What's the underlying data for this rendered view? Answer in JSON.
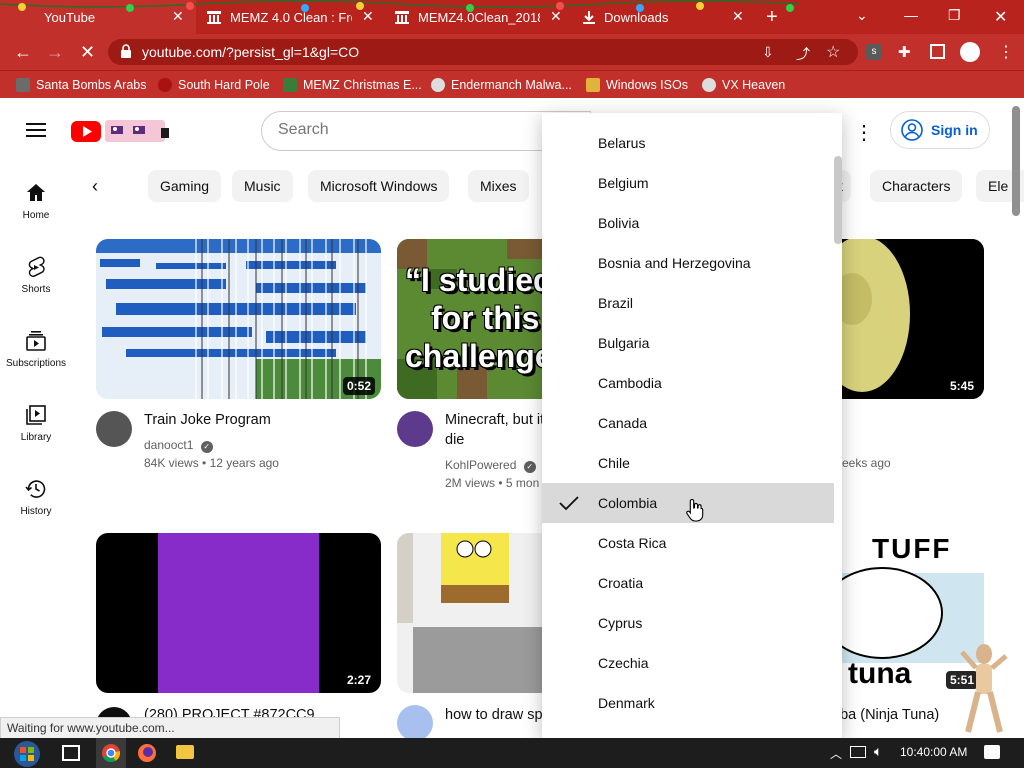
{
  "browser": {
    "tabs": [
      {
        "title": "YouTube",
        "active": true
      },
      {
        "title": "MEMZ 4.0 Clean : Free"
      },
      {
        "title": "MEMZ4.0Clean_20181"
      },
      {
        "title": "Downloads"
      }
    ],
    "url": "youtube.com/?persist_gl=1&gl=CO",
    "bookmarks": [
      "Santa Bombs Arabs",
      "South Hard Pole",
      "MEMZ Christmas E...",
      "Endermanch Malwa...",
      "Windows ISOs",
      "VX Heaven"
    ],
    "status_text": "Waiting for www.youtube.com..."
  },
  "youtube": {
    "search_placeholder": "Search",
    "signin_label": "Sign in",
    "side_nav": [
      {
        "label": "Home",
        "icon": "home-icon"
      },
      {
        "label": "Shorts",
        "icon": "shorts-icon"
      },
      {
        "label": "Subscriptions",
        "icon": "subscriptions-icon"
      },
      {
        "label": "Library",
        "icon": "library-icon"
      },
      {
        "label": "History",
        "icon": "history-icon"
      }
    ],
    "chips": [
      "Gaming",
      "Music",
      "Microsoft Windows",
      "Mixes",
      "k",
      "Characters",
      "Ele"
    ],
    "videos": [
      {
        "title": "Train Joke Program",
        "channel": "danooct1",
        "views": "84K views",
        "age": "12 years ago",
        "duration": "0:52"
      },
      {
        "title": "Minecraft, but it",
        "title2": "die",
        "channel": "KohlPowered",
        "views": "2M views",
        "age": "5 mon",
        "duration": ""
      },
      {
        "title": "",
        "channel": "",
        "views": "",
        "age": "eeks ago",
        "duration": "5:45"
      },
      {
        "title": "(280) PROJECT #872CC9",
        "channel": "",
        "views": "",
        "age": "",
        "duration": "2:27"
      },
      {
        "title": "how to draw spo",
        "channel": "",
        "views": "",
        "age": "",
        "duration": ""
      },
      {
        "title": "mba (Ninja Tuna)",
        "channel": "",
        "views": "",
        "age": "",
        "duration": "5:51"
      }
    ],
    "thumb_text": {
      "minecraft": [
        "“I studied",
        "for this",
        "challenge"
      ],
      "tuna": [
        "TUFF",
        "tuna"
      ]
    }
  },
  "country_menu": {
    "options": [
      "Belarus",
      "Belgium",
      "Bolivia",
      "Bosnia and Herzegovina",
      "Brazil",
      "Bulgaria",
      "Cambodia",
      "Canada",
      "Chile",
      "Colombia",
      "Costa Rica",
      "Croatia",
      "Cyprus",
      "Czechia",
      "Denmark"
    ],
    "selected": "Colombia"
  },
  "taskbar": {
    "clock": "10:40:00 AM"
  },
  "colors": {
    "chrome_red": "#b8231d",
    "youtube_red": "#ff0000",
    "link_blue": "#065fd4"
  }
}
